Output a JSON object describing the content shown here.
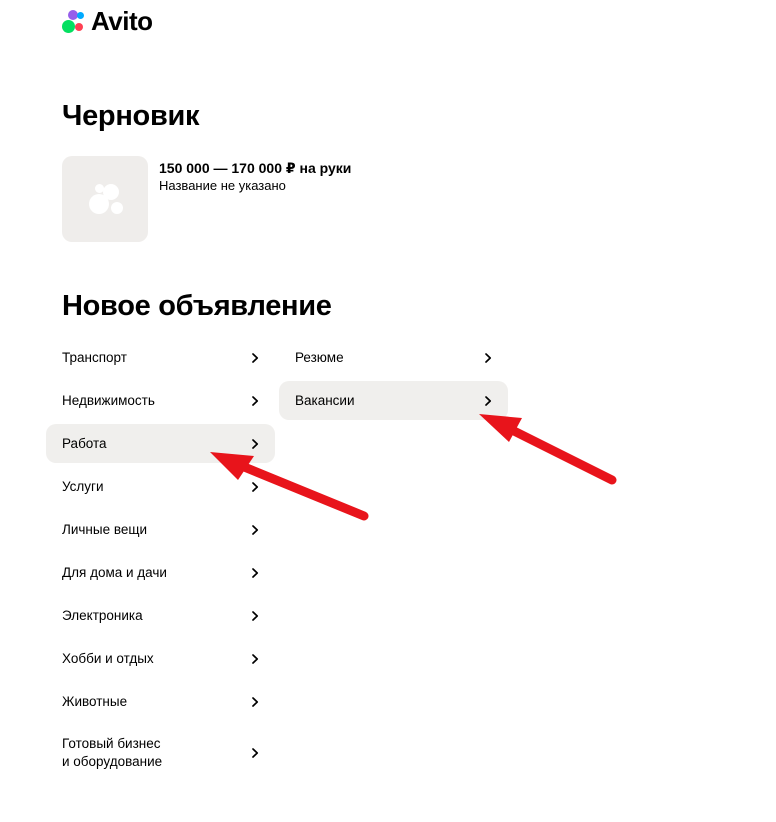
{
  "brand": {
    "name": "Avito",
    "dot_colors": [
      "#04e061",
      "#ff4053",
      "#965eeb",
      "#0af"
    ]
  },
  "draft": {
    "heading": "Черновик",
    "price": "150 000 — 170 000 ₽ на руки",
    "name": "Название не указано"
  },
  "new_ad": {
    "heading": "Новое объявление",
    "categories": [
      {
        "label": "Транспорт",
        "active": false
      },
      {
        "label": "Недвижимость",
        "active": false
      },
      {
        "label": "Работа",
        "active": true
      },
      {
        "label": "Услуги",
        "active": false
      },
      {
        "label": "Личные вещи",
        "active": false
      },
      {
        "label": "Для дома и дачи",
        "active": false
      },
      {
        "label": "Электроника",
        "active": false
      },
      {
        "label": "Хобби и отдых",
        "active": false
      },
      {
        "label": "Животные",
        "active": false
      },
      {
        "label": "Готовый бизнес\nи оборудование",
        "active": false
      }
    ],
    "subcategories": [
      {
        "label": "Резюме",
        "active": false
      },
      {
        "label": "Вакансии",
        "active": true
      }
    ]
  },
  "annotation_color": "#e8141b"
}
